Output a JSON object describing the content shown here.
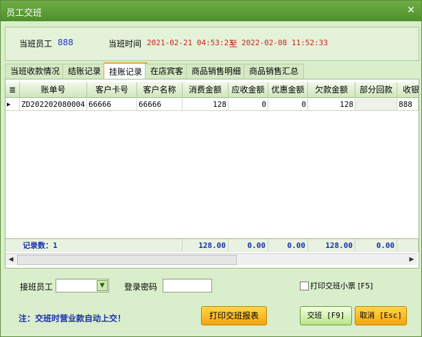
{
  "window": {
    "title": "员工交班",
    "close_icon": "✕"
  },
  "info": {
    "staff_label": "当班员工",
    "staff_value": "888",
    "time_label": "当班时间",
    "time_start": "2021-02-21 04:53:23",
    "time_to": "至",
    "time_end": "2022-02-08 11:52:33"
  },
  "tabs": [
    {
      "label": "当班收款情况"
    },
    {
      "label": "结账记录"
    },
    {
      "label": "挂账记录"
    },
    {
      "label": "在店宾客"
    },
    {
      "label": "商品销售明细"
    },
    {
      "label": "商品销售汇总"
    }
  ],
  "table": {
    "columns": [
      "账单号",
      "客户卡号",
      "客户名称",
      "消费金额",
      "应收金额",
      "优惠金额",
      "欠款金额",
      "部分回款",
      "收银"
    ],
    "rows": [
      [
        "ZD202202080004",
        "66666",
        "66666",
        "128",
        "0",
        "0",
        "128",
        "",
        "888"
      ]
    ],
    "footer": {
      "record_count": "记录数：1",
      "totals": [
        "128.00",
        "0.00",
        "0.00",
        "128.00",
        "0.00"
      ]
    }
  },
  "form": {
    "next_staff_label": "接班员工",
    "password_label": "登录密码",
    "print_ticket_label": "打印交班小票 [F5]"
  },
  "note": "注：交班时营业款自动上交！",
  "buttons": {
    "print_report": "打印交班报表",
    "handover": "交班 [F9]",
    "cancel": "取消 [Esc]"
  }
}
